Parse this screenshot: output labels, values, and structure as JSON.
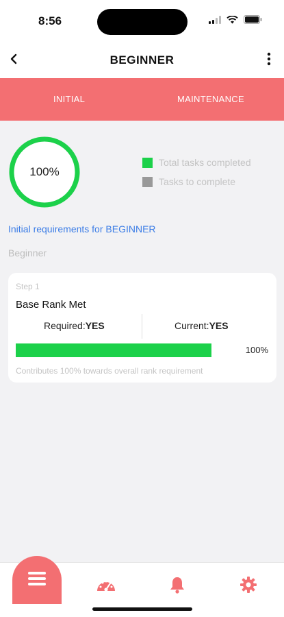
{
  "status_bar": {
    "time": "8:56"
  },
  "header": {
    "title": "BEGINNER"
  },
  "tabs": [
    {
      "label": "INITIAL"
    },
    {
      "label": "MAINTENANCE"
    }
  ],
  "progress": {
    "percent_label": "100%",
    "completion": 1.0,
    "legend": [
      {
        "label": "Total tasks completed",
        "color": "#1cd14a"
      },
      {
        "label": "Tasks to complete",
        "color": "#999999"
      }
    ]
  },
  "requirements_link": "Initial requirements for BEGINNER",
  "section_label": "Beginner",
  "step_card": {
    "step_label": "Step 1",
    "title": "Base Rank Met",
    "required_label": "Required:",
    "required_value": "YES",
    "current_label": "Current:",
    "current_value": "YES",
    "progress_percent": 100,
    "progress_label": "100%",
    "contribution": "Contributes 100% towards overall rank requirement"
  },
  "bottom_nav": [
    {
      "icon": "list-icon",
      "active": true
    },
    {
      "icon": "gauge-icon",
      "active": false
    },
    {
      "icon": "bell-icon",
      "active": false
    },
    {
      "icon": "gear-icon",
      "active": false
    }
  ],
  "colors": {
    "accent": "#f36f72",
    "success": "#1cd14a",
    "link": "#3c7de6"
  }
}
